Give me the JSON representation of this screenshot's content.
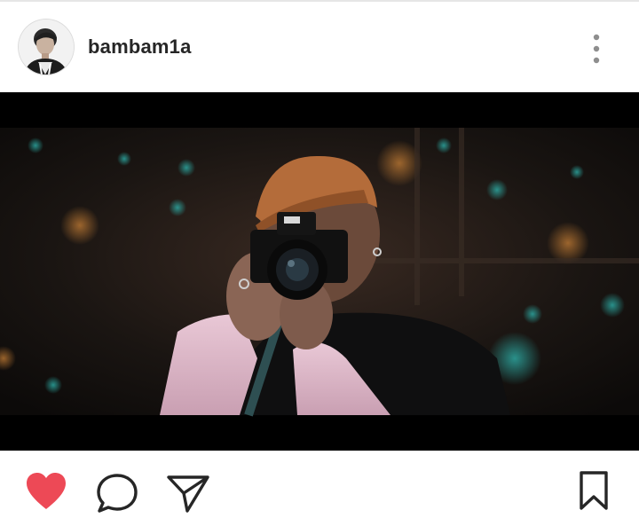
{
  "post": {
    "username": "bambam1a"
  },
  "icons": {
    "avatar": "profile-avatar",
    "more": "more-vertical-icon",
    "like": "heart-filled-icon",
    "comment": "comment-bubble-icon",
    "share": "send-paper-plane-icon",
    "save": "bookmark-icon"
  },
  "colors": {
    "like_active": "#ed4956",
    "icon_stroke": "#262626",
    "text": "#262626"
  }
}
